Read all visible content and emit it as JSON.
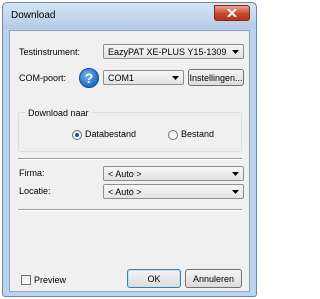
{
  "window": {
    "title": "Download"
  },
  "form": {
    "testinstrument_label": "Testinstrument:",
    "testinstrument_value": "EazyPAT XE-PLUS Y15-1309",
    "comport_label": "COM-poort:",
    "help_glyph": "?",
    "comport_value": "COM1",
    "settings_button": "Instellingen..."
  },
  "download_group": {
    "label": "Download naar",
    "options": [
      {
        "label": "Databestand",
        "selected": true
      },
      {
        "label": "Bestand",
        "selected": false
      }
    ]
  },
  "details": {
    "firma_label": "Firma:",
    "firma_value": "< Auto >",
    "locatie_label": "Locatie:",
    "locatie_value": "< Auto >"
  },
  "footer": {
    "preview_label": "Preview",
    "preview_checked": false,
    "ok_button": "OK",
    "cancel_button": "Annuleren"
  },
  "colors": {
    "frame": "#bcd3ee",
    "close_button": "#c7432a",
    "help_icon": "#1f6fc3",
    "radio_dot": "#1a4fa5"
  }
}
